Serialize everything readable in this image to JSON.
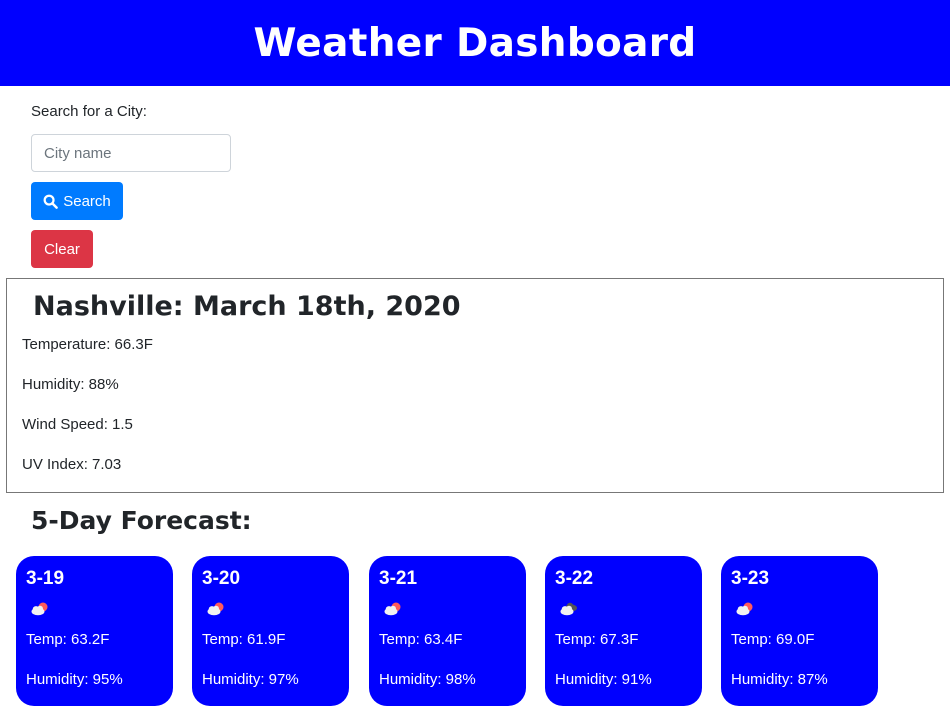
{
  "header": {
    "title": "Weather Dashboard"
  },
  "search": {
    "label": "Search for a City:",
    "placeholder": "City name",
    "value": "",
    "search_button_label": "Search",
    "clear_button_label": "Clear"
  },
  "current": {
    "title": "Nashville: March 18th, 2020",
    "temperature": "Temperature: 66.3F",
    "humidity": "Humidity: 88%",
    "wind_speed": "Wind Speed: 1.5",
    "uv_index": "UV Index: 7.03"
  },
  "forecast": {
    "heading": "5-Day Forecast:",
    "days": [
      {
        "date": "3-19",
        "icon": "cloudy-day-icon",
        "temp": "Temp: 63.2F",
        "humidity": "Humidity: 95%"
      },
      {
        "date": "3-20",
        "icon": "cloudy-day-icon",
        "temp": "Temp: 61.9F",
        "humidity": "Humidity: 97%"
      },
      {
        "date": "3-21",
        "icon": "cloudy-day-icon",
        "temp": "Temp: 63.4F",
        "humidity": "Humidity: 98%"
      },
      {
        "date": "3-22",
        "icon": "cloudy-night-icon",
        "temp": "Temp: 67.3F",
        "humidity": "Humidity: 91%"
      },
      {
        "date": "3-23",
        "icon": "cloudy-day-icon",
        "temp": "Temp: 69.0F",
        "humidity": "Humidity: 87%"
      }
    ]
  },
  "colors": {
    "header_bg": "#0000ff",
    "card_bg": "#0000ff",
    "search_button": "#007bff",
    "clear_button": "#dc3545"
  }
}
